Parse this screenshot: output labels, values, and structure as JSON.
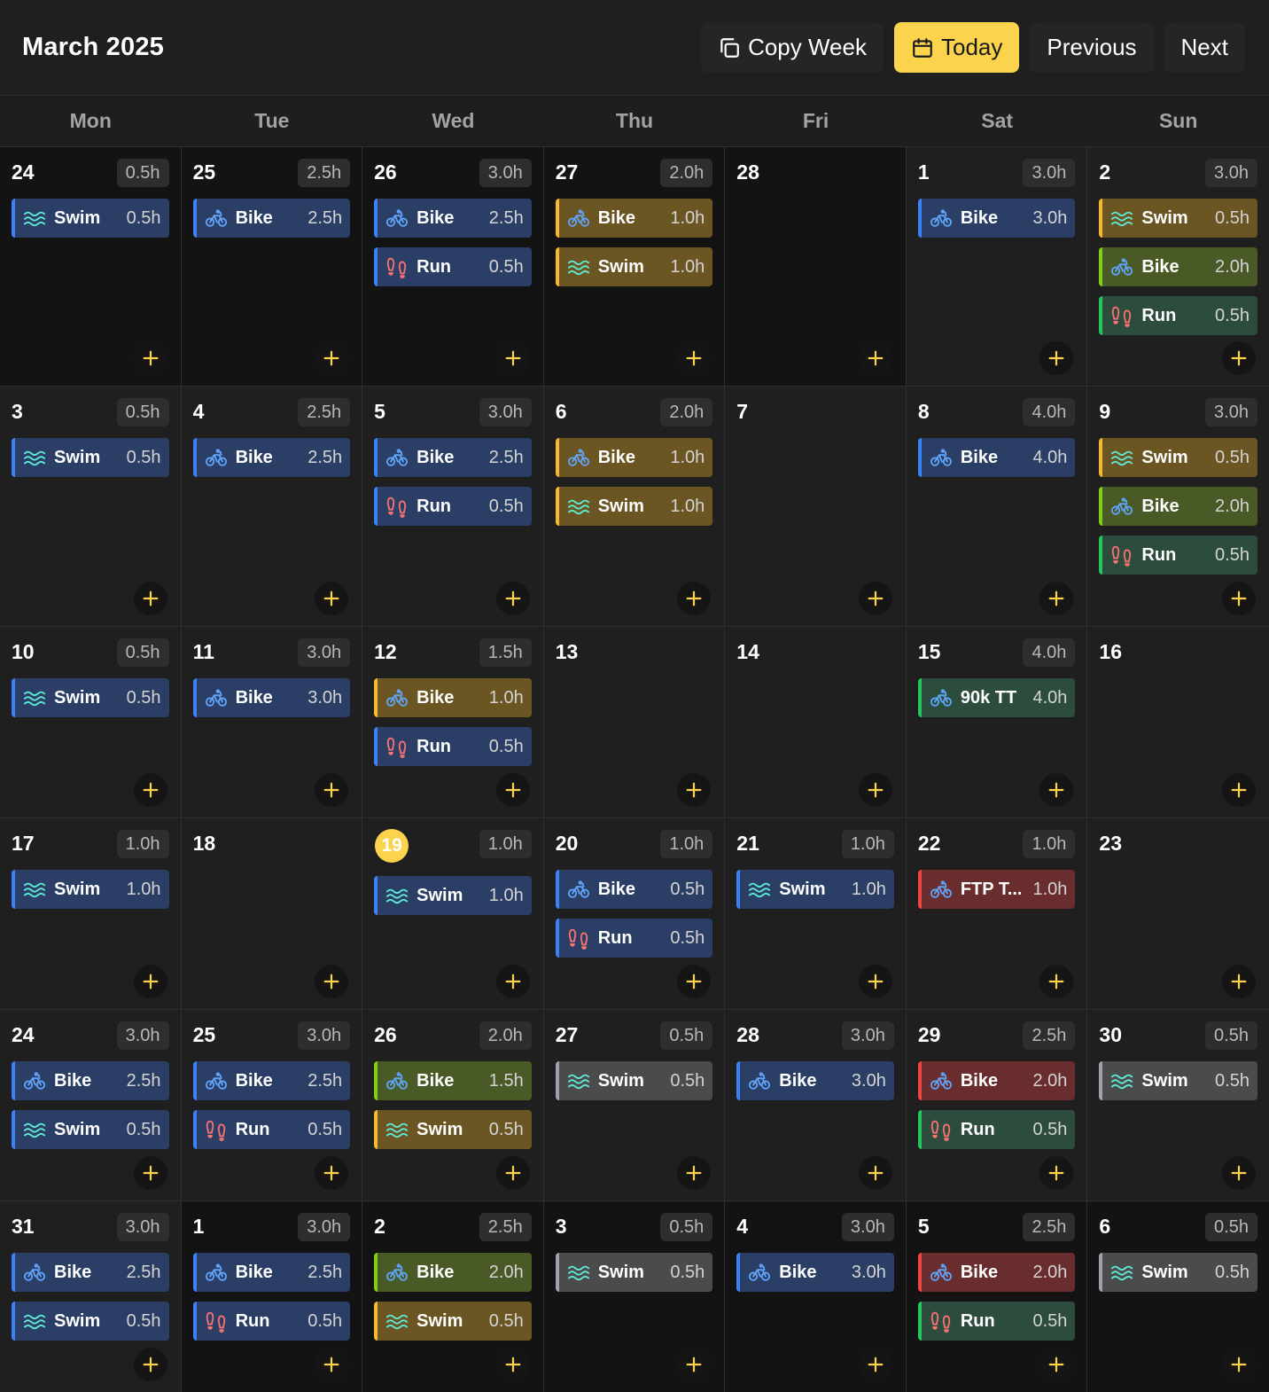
{
  "header": {
    "title": "March 2025",
    "copy_week": "Copy Week",
    "today": "Today",
    "previous": "Previous",
    "next": "Next"
  },
  "colors": {
    "accent": "#fcd34d",
    "swim_icon": "#5eead4",
    "bike_icon": "#60a5fa",
    "run_icon": "#f87171"
  },
  "weekdays": [
    "Mon",
    "Tue",
    "Wed",
    "Thu",
    "Fri",
    "Sat",
    "Sun"
  ],
  "days": [
    {
      "day": "24",
      "total": "0.5h",
      "dim": true,
      "events": [
        {
          "sport": "swim",
          "name": "Swim",
          "dur": "0.5h",
          "color": "blue"
        }
      ]
    },
    {
      "day": "25",
      "total": "2.5h",
      "dim": true,
      "events": [
        {
          "sport": "bike",
          "name": "Bike",
          "dur": "2.5h",
          "color": "blue"
        }
      ]
    },
    {
      "day": "26",
      "total": "3.0h",
      "dim": true,
      "events": [
        {
          "sport": "bike",
          "name": "Bike",
          "dur": "2.5h",
          "color": "blue"
        },
        {
          "sport": "run",
          "name": "Run",
          "dur": "0.5h",
          "color": "blue"
        }
      ]
    },
    {
      "day": "27",
      "total": "2.0h",
      "dim": true,
      "events": [
        {
          "sport": "bike",
          "name": "Bike",
          "dur": "1.0h",
          "color": "amber"
        },
        {
          "sport": "swim",
          "name": "Swim",
          "dur": "1.0h",
          "color": "amber"
        }
      ]
    },
    {
      "day": "28",
      "total": "",
      "dim": true,
      "events": []
    },
    {
      "day": "1",
      "total": "3.0h",
      "dim": false,
      "events": [
        {
          "sport": "bike",
          "name": "Bike",
          "dur": "3.0h",
          "color": "blue"
        }
      ]
    },
    {
      "day": "2",
      "total": "3.0h",
      "dim": false,
      "events": [
        {
          "sport": "swim",
          "name": "Swim",
          "dur": "0.5h",
          "color": "amber"
        },
        {
          "sport": "bike",
          "name": "Bike",
          "dur": "2.0h",
          "color": "olive"
        },
        {
          "sport": "run",
          "name": "Run",
          "dur": "0.5h",
          "color": "green"
        }
      ]
    },
    {
      "day": "3",
      "total": "0.5h",
      "dim": false,
      "events": [
        {
          "sport": "swim",
          "name": "Swim",
          "dur": "0.5h",
          "color": "blue"
        }
      ]
    },
    {
      "day": "4",
      "total": "2.5h",
      "dim": false,
      "events": [
        {
          "sport": "bike",
          "name": "Bike",
          "dur": "2.5h",
          "color": "blue"
        }
      ]
    },
    {
      "day": "5",
      "total": "3.0h",
      "dim": false,
      "events": [
        {
          "sport": "bike",
          "name": "Bike",
          "dur": "2.5h",
          "color": "blue"
        },
        {
          "sport": "run",
          "name": "Run",
          "dur": "0.5h",
          "color": "blue"
        }
      ]
    },
    {
      "day": "6",
      "total": "2.0h",
      "dim": false,
      "events": [
        {
          "sport": "bike",
          "name": "Bike",
          "dur": "1.0h",
          "color": "amber"
        },
        {
          "sport": "swim",
          "name": "Swim",
          "dur": "1.0h",
          "color": "amber"
        }
      ]
    },
    {
      "day": "7",
      "total": "",
      "dim": false,
      "events": []
    },
    {
      "day": "8",
      "total": "4.0h",
      "dim": false,
      "events": [
        {
          "sport": "bike",
          "name": "Bike",
          "dur": "4.0h",
          "color": "blue"
        }
      ]
    },
    {
      "day": "9",
      "total": "3.0h",
      "dim": false,
      "events": [
        {
          "sport": "swim",
          "name": "Swim",
          "dur": "0.5h",
          "color": "amber"
        },
        {
          "sport": "bike",
          "name": "Bike",
          "dur": "2.0h",
          "color": "olive"
        },
        {
          "sport": "run",
          "name": "Run",
          "dur": "0.5h",
          "color": "green"
        }
      ]
    },
    {
      "day": "10",
      "total": "0.5h",
      "dim": false,
      "events": [
        {
          "sport": "swim",
          "name": "Swim",
          "dur": "0.5h",
          "color": "blue"
        }
      ]
    },
    {
      "day": "11",
      "total": "3.0h",
      "dim": false,
      "events": [
        {
          "sport": "bike",
          "name": "Bike",
          "dur": "3.0h",
          "color": "blue"
        }
      ]
    },
    {
      "day": "12",
      "total": "1.5h",
      "dim": false,
      "events": [
        {
          "sport": "bike",
          "name": "Bike",
          "dur": "1.0h",
          "color": "amber"
        },
        {
          "sport": "run",
          "name": "Run",
          "dur": "0.5h",
          "color": "blue"
        }
      ]
    },
    {
      "day": "13",
      "total": "",
      "dim": false,
      "events": []
    },
    {
      "day": "14",
      "total": "",
      "dim": false,
      "events": []
    },
    {
      "day": "15",
      "total": "4.0h",
      "dim": false,
      "events": [
        {
          "sport": "bike",
          "name": "90k TT",
          "dur": "4.0h",
          "color": "green"
        }
      ]
    },
    {
      "day": "16",
      "total": "",
      "dim": false,
      "events": []
    },
    {
      "day": "17",
      "total": "1.0h",
      "dim": false,
      "events": [
        {
          "sport": "swim",
          "name": "Swim",
          "dur": "1.0h",
          "color": "blue"
        }
      ]
    },
    {
      "day": "18",
      "total": "",
      "dim": false,
      "events": []
    },
    {
      "day": "19",
      "total": "1.0h",
      "dim": false,
      "today": true,
      "events": [
        {
          "sport": "swim",
          "name": "Swim",
          "dur": "1.0h",
          "color": "blue"
        }
      ]
    },
    {
      "day": "20",
      "total": "1.0h",
      "dim": false,
      "events": [
        {
          "sport": "bike",
          "name": "Bike",
          "dur": "0.5h",
          "color": "blue"
        },
        {
          "sport": "run",
          "name": "Run",
          "dur": "0.5h",
          "color": "blue"
        }
      ]
    },
    {
      "day": "21",
      "total": "1.0h",
      "dim": false,
      "events": [
        {
          "sport": "swim",
          "name": "Swim",
          "dur": "1.0h",
          "color": "blue"
        }
      ]
    },
    {
      "day": "22",
      "total": "1.0h",
      "dim": false,
      "events": [
        {
          "sport": "bike",
          "name": "FTP T...",
          "dur": "1.0h",
          "color": "red"
        }
      ]
    },
    {
      "day": "23",
      "total": "",
      "dim": false,
      "events": []
    },
    {
      "day": "24",
      "total": "3.0h",
      "dim": false,
      "events": [
        {
          "sport": "bike",
          "name": "Bike",
          "dur": "2.5h",
          "color": "blue"
        },
        {
          "sport": "swim",
          "name": "Swim",
          "dur": "0.5h",
          "color": "blue"
        }
      ]
    },
    {
      "day": "25",
      "total": "3.0h",
      "dim": false,
      "events": [
        {
          "sport": "bike",
          "name": "Bike",
          "dur": "2.5h",
          "color": "blue"
        },
        {
          "sport": "run",
          "name": "Run",
          "dur": "0.5h",
          "color": "blue"
        }
      ]
    },
    {
      "day": "26",
      "total": "2.0h",
      "dim": false,
      "events": [
        {
          "sport": "bike",
          "name": "Bike",
          "dur": "1.5h",
          "color": "olive"
        },
        {
          "sport": "swim",
          "name": "Swim",
          "dur": "0.5h",
          "color": "amber"
        }
      ]
    },
    {
      "day": "27",
      "total": "0.5h",
      "dim": false,
      "events": [
        {
          "sport": "swim",
          "name": "Swim",
          "dur": "0.5h",
          "color": "gray"
        }
      ]
    },
    {
      "day": "28",
      "total": "3.0h",
      "dim": false,
      "events": [
        {
          "sport": "bike",
          "name": "Bike",
          "dur": "3.0h",
          "color": "blue"
        }
      ]
    },
    {
      "day": "29",
      "total": "2.5h",
      "dim": false,
      "events": [
        {
          "sport": "bike",
          "name": "Bike",
          "dur": "2.0h",
          "color": "red"
        },
        {
          "sport": "run",
          "name": "Run",
          "dur": "0.5h",
          "color": "green"
        }
      ]
    },
    {
      "day": "30",
      "total": "0.5h",
      "dim": false,
      "events": [
        {
          "sport": "swim",
          "name": "Swim",
          "dur": "0.5h",
          "color": "gray"
        }
      ]
    },
    {
      "day": "31",
      "total": "3.0h",
      "dim": false,
      "events": [
        {
          "sport": "bike",
          "name": "Bike",
          "dur": "2.5h",
          "color": "blue"
        },
        {
          "sport": "swim",
          "name": "Swim",
          "dur": "0.5h",
          "color": "blue"
        }
      ]
    },
    {
      "day": "1",
      "total": "3.0h",
      "dim": true,
      "events": [
        {
          "sport": "bike",
          "name": "Bike",
          "dur": "2.5h",
          "color": "blue"
        },
        {
          "sport": "run",
          "name": "Run",
          "dur": "0.5h",
          "color": "blue"
        }
      ]
    },
    {
      "day": "2",
      "total": "2.5h",
      "dim": true,
      "events": [
        {
          "sport": "bike",
          "name": "Bike",
          "dur": "2.0h",
          "color": "olive"
        },
        {
          "sport": "swim",
          "name": "Swim",
          "dur": "0.5h",
          "color": "amber"
        }
      ]
    },
    {
      "day": "3",
      "total": "0.5h",
      "dim": true,
      "events": [
        {
          "sport": "swim",
          "name": "Swim",
          "dur": "0.5h",
          "color": "gray"
        }
      ]
    },
    {
      "day": "4",
      "total": "3.0h",
      "dim": true,
      "events": [
        {
          "sport": "bike",
          "name": "Bike",
          "dur": "3.0h",
          "color": "blue"
        }
      ]
    },
    {
      "day": "5",
      "total": "2.5h",
      "dim": true,
      "events": [
        {
          "sport": "bike",
          "name": "Bike",
          "dur": "2.0h",
          "color": "red"
        },
        {
          "sport": "run",
          "name": "Run",
          "dur": "0.5h",
          "color": "green"
        }
      ]
    },
    {
      "day": "6",
      "total": "0.5h",
      "dim": true,
      "events": [
        {
          "sport": "swim",
          "name": "Swim",
          "dur": "0.5h",
          "color": "gray"
        }
      ]
    }
  ]
}
